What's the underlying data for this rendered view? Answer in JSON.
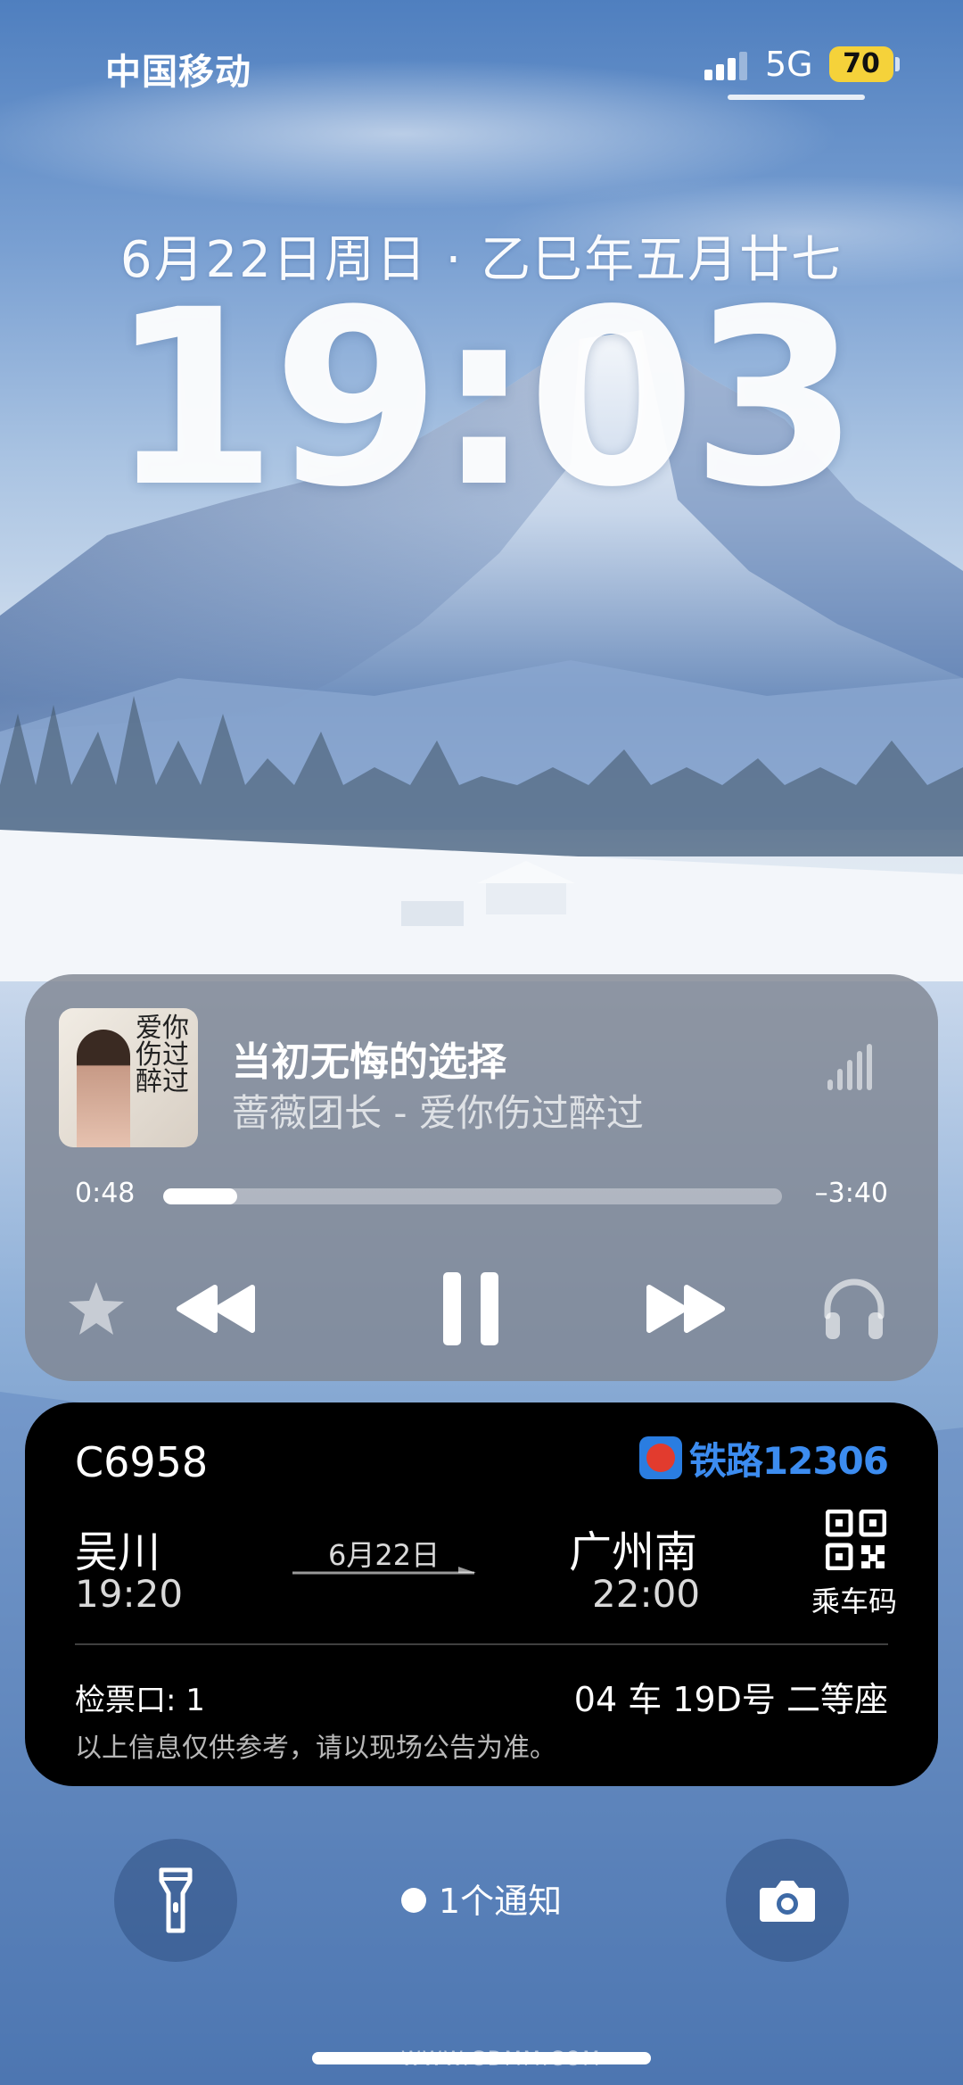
{
  "status_bar": {
    "carrier": "中国移动",
    "network": "5G",
    "battery": "70",
    "signal_bars": 4,
    "signal_bars_active": 3
  },
  "lock_screen": {
    "date_line": "6月22日周日 · 乙巳年五月廿七",
    "time": "19:03"
  },
  "now_playing": {
    "title": "当初无悔的选择",
    "artist_album": "蔷薇团长 - 爱你伤过醉过",
    "cover_text": "爱你伤过醉过",
    "elapsed": "0:48",
    "remaining": "–3:40",
    "progress_fraction": 0.12,
    "controls": [
      "star-icon",
      "rewind-icon",
      "pause-icon",
      "fast-forward-icon",
      "headphones-icon"
    ]
  },
  "train_ticket": {
    "train_no": "C6958",
    "brand": "铁路12306",
    "from_station": "吴川",
    "depart_time": "19:20",
    "date": "6月22日",
    "to_station": "广州南",
    "arrive_time": "22:00",
    "qr_label": "乘车码",
    "gate": "检票口: 1",
    "seat": "04 车 19D号 二等座",
    "notice": "以上信息仅供参考，请以现场公告为准。",
    "accent": "#3c8cf0"
  },
  "bottom": {
    "notifications": "1个通知",
    "left_button_icon": "flashlight-icon",
    "right_button_icon": "camera-icon"
  },
  "watermark": "WWW.GDMM.COM"
}
